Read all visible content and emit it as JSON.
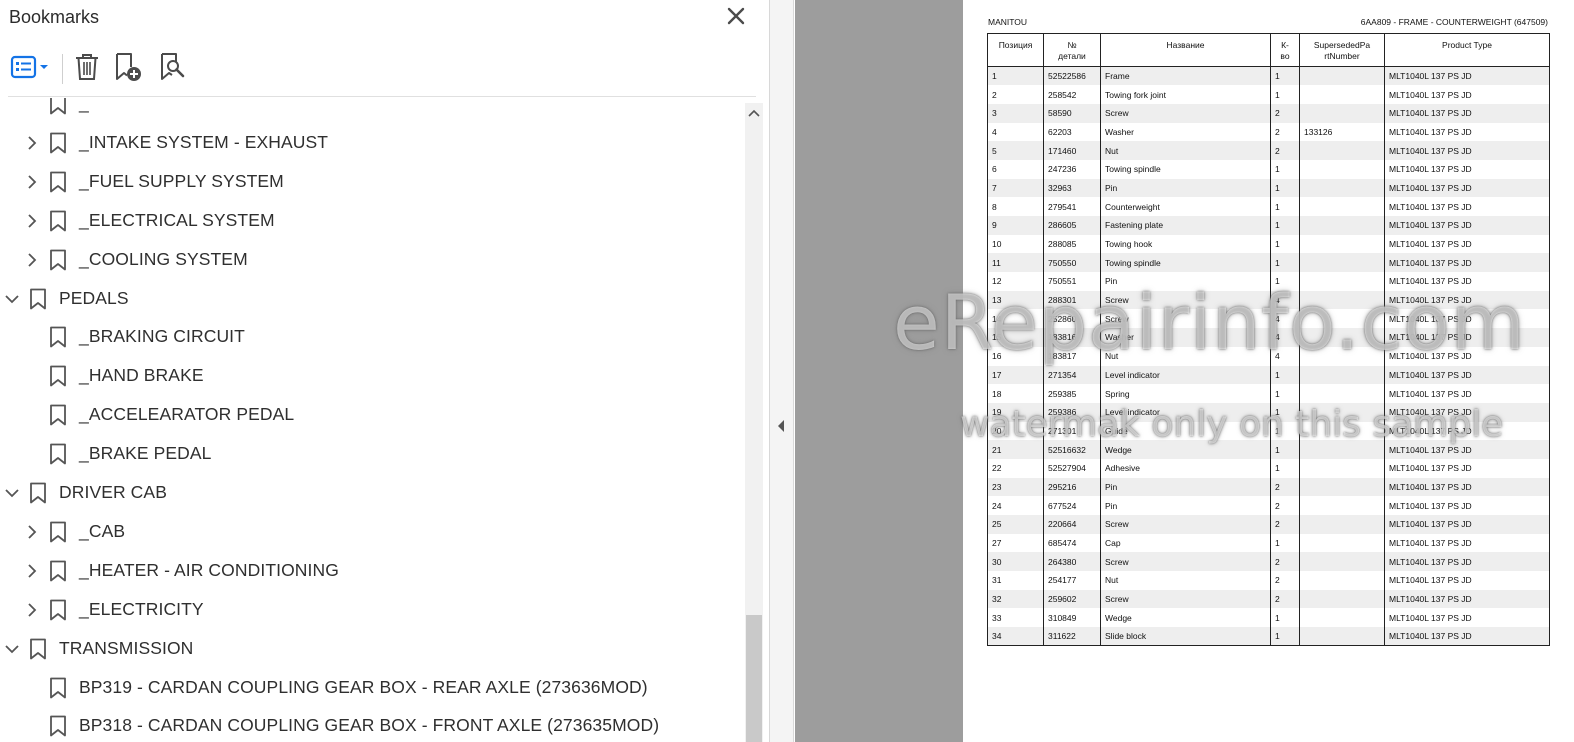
{
  "panel": {
    "title": "Bookmarks",
    "toolbar": {
      "options_icon": "list-options-icon",
      "delete_icon": "trash-icon",
      "add_icon": "bookmark-add-icon",
      "find_icon": "bookmark-find-icon"
    }
  },
  "bookmarks": [
    {
      "label": "_",
      "level": 1,
      "chevron": "none",
      "partial": true
    },
    {
      "label": "_INTAKE SYSTEM - EXHAUST",
      "level": 1,
      "chevron": "right"
    },
    {
      "label": "_FUEL SUPPLY SYSTEM",
      "level": 1,
      "chevron": "right"
    },
    {
      "label": "_ELECTRICAL SYSTEM",
      "level": 1,
      "chevron": "right"
    },
    {
      "label": "_COOLING SYSTEM",
      "level": 1,
      "chevron": "right"
    },
    {
      "label": "PEDALS",
      "level": 0,
      "chevron": "down"
    },
    {
      "label": "_BRAKING CIRCUIT",
      "level": 1,
      "chevron": "none"
    },
    {
      "label": "_HAND BRAKE",
      "level": 1,
      "chevron": "none"
    },
    {
      "label": "_ACCELEARATOR PEDAL",
      "level": 1,
      "chevron": "none"
    },
    {
      "label": "_BRAKE PEDAL",
      "level": 1,
      "chevron": "none"
    },
    {
      "label": "DRIVER CAB",
      "level": 0,
      "chevron": "down"
    },
    {
      "label": "_CAB",
      "level": 1,
      "chevron": "right"
    },
    {
      "label": "_HEATER - AIR CONDITIONING",
      "level": 1,
      "chevron": "right"
    },
    {
      "label": "_ELECTRICITY",
      "level": 1,
      "chevron": "right"
    },
    {
      "label": "TRANSMISSION",
      "level": 0,
      "chevron": "down"
    },
    {
      "label": "BP319 - CARDAN COUPLING GEAR BOX - REAR AXLE (273636MOD)",
      "level": 1,
      "chevron": "none"
    },
    {
      "label": "BP318 - CARDAN COUPLING GEAR BOX - FRONT AXLE (273635MOD)",
      "level": 1,
      "chevron": "none"
    }
  ],
  "document": {
    "header_left": "MANITOU",
    "header_right": "6AA809 - FRAME - COUNTERWEIGHT (647509)",
    "columns": [
      "Позиция",
      "№ детали",
      "Название",
      "К-во",
      "SupersededPartNumber",
      "Product Type"
    ],
    "columns_display": [
      "Позиция",
      "№\nдетали",
      "Название",
      "К-\nво",
      "SupersededPa\nrtNumber",
      "Product Type"
    ],
    "rows": [
      [
        "1",
        "52522586",
        "Frame",
        "1",
        "",
        "MLT1040L 137 PS JD"
      ],
      [
        "2",
        "258542",
        "Towing fork joint",
        "1",
        "",
        "MLT1040L 137 PS JD"
      ],
      [
        "3",
        "58590",
        "Screw",
        "2",
        "",
        "MLT1040L 137 PS JD"
      ],
      [
        "4",
        "62203",
        "Washer",
        "2",
        "133126",
        "MLT1040L 137 PS JD"
      ],
      [
        "5",
        "171460",
        "Nut",
        "2",
        "",
        "MLT1040L 137 PS JD"
      ],
      [
        "6",
        "247236",
        "Towing spindle",
        "1",
        "",
        "MLT1040L 137 PS JD"
      ],
      [
        "7",
        "32963",
        "Pin",
        "1",
        "",
        "MLT1040L 137 PS JD"
      ],
      [
        "8",
        "279541",
        "Counterweight",
        "1",
        "",
        "MLT1040L 137 PS JD"
      ],
      [
        "9",
        "286605",
        "Fastening plate",
        "1",
        "",
        "MLT1040L 137 PS JD"
      ],
      [
        "10",
        "288085",
        "Towing hook",
        "1",
        "",
        "MLT1040L 137 PS JD"
      ],
      [
        "11",
        "750550",
        "Towing spindle",
        "1",
        "",
        "MLT1040L 137 PS JD"
      ],
      [
        "12",
        "750551",
        "Pin",
        "1",
        "",
        "MLT1040L 137 PS JD"
      ],
      [
        "13",
        "288301",
        "Screw",
        "4",
        "",
        "MLT1040L 137 PS JD"
      ],
      [
        "14",
        "252860",
        "Screw",
        "4",
        "",
        "MLT1040L 137 PS JD"
      ],
      [
        "15",
        "183816",
        "Washer",
        "4",
        "",
        "MLT1040L 137 PS JD"
      ],
      [
        "16",
        "183817",
        "Nut",
        "4",
        "",
        "MLT1040L 137 PS JD"
      ],
      [
        "17",
        "271354",
        "Level indicator",
        "1",
        "",
        "MLT1040L 137 PS JD"
      ],
      [
        "18",
        "259385",
        "Spring",
        "1",
        "",
        "MLT1040L 137 PS JD"
      ],
      [
        "19",
        "259386",
        "Level indicator",
        "1",
        "",
        "MLT1040L 137 PS JD"
      ],
      [
        "20",
        "271301",
        "Guide",
        "1",
        "",
        "MLT1040L 137 PS JD"
      ],
      [
        "21",
        "52516632",
        "Wedge",
        "1",
        "",
        "MLT1040L 137 PS JD"
      ],
      [
        "22",
        "52527904",
        "Adhesive",
        "1",
        "",
        "MLT1040L 137 PS JD"
      ],
      [
        "23",
        "295216",
        "Pin",
        "2",
        "",
        "MLT1040L 137 PS JD"
      ],
      [
        "24",
        "677524",
        "Pin",
        "2",
        "",
        "MLT1040L 137 PS JD"
      ],
      [
        "25",
        "220664",
        "Screw",
        "2",
        "",
        "MLT1040L 137 PS JD"
      ],
      [
        "27",
        "685474",
        "Cap",
        "1",
        "",
        "MLT1040L 137 PS JD"
      ],
      [
        "30",
        "264380",
        "Screw",
        "2",
        "",
        "MLT1040L 137 PS JD"
      ],
      [
        "31",
        "254177",
        "Nut",
        "2",
        "",
        "MLT1040L 137 PS JD"
      ],
      [
        "32",
        "259602",
        "Screw",
        "2",
        "",
        "MLT1040L 137 PS JD"
      ],
      [
        "33",
        "310849",
        "Wedge",
        "1",
        "",
        "MLT1040L 137 PS JD"
      ],
      [
        "34",
        "311622",
        "Slide block",
        "1",
        "",
        "MLT1040L 137 PS JD"
      ]
    ]
  },
  "watermark": {
    "main": "eRepairinfo.com",
    "sub": "watermak only on this sample"
  },
  "colors": {
    "accent": "#1473e6",
    "icon": "#4b4b4b",
    "stripe": "#eeeeee",
    "doc_bg": "#9d9d9d"
  }
}
